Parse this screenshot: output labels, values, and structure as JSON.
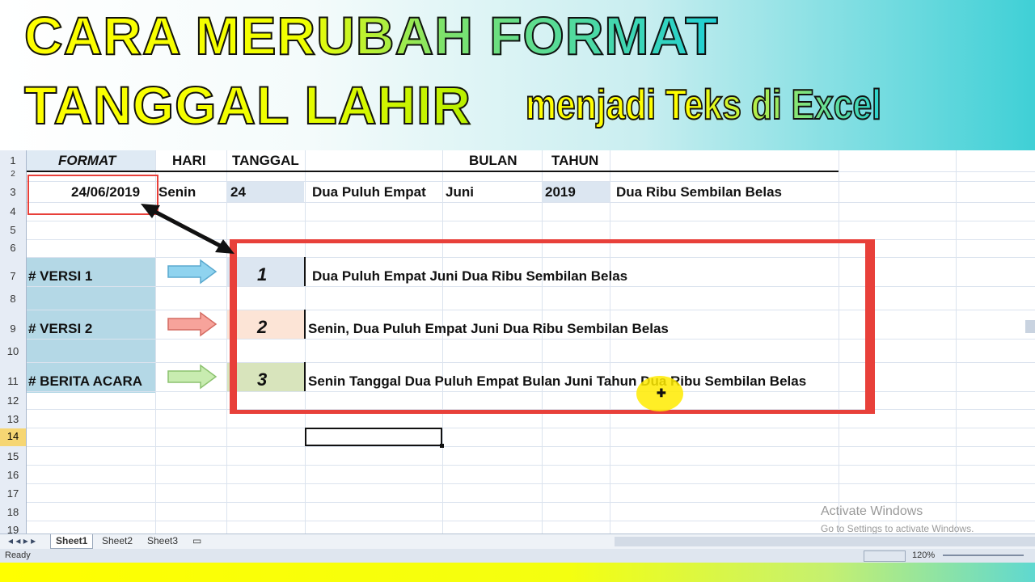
{
  "title": {
    "line1": "CARA MERUBAH FORMAT",
    "line2": "TANGGAL LAHIR",
    "line3": "menjadi Teks di Excel"
  },
  "headers": {
    "format": "FORMAT",
    "hari": "HARI",
    "tanggal": "TANGGAL",
    "bulan": "BULAN",
    "tahun": "TAHUN"
  },
  "row3": {
    "date": "24/06/2019",
    "day": "Senin",
    "tgl": "24",
    "tgl_text": "Dua Puluh Empat",
    "bulan": "Juni",
    "tahun": "2019",
    "tahun_text": "Dua Ribu Sembilan Belas"
  },
  "rows": [
    {
      "label": "# VERSI 1",
      "num": "1",
      "text": "Dua Puluh Empat Juni  Dua Ribu Sembilan Belas",
      "arrow_color": "#8fd3ef"
    },
    {
      "label": "# VERSI 2",
      "num": "2",
      "text": "Senin,  Dua Puluh Empat Juni  Dua Ribu Sembilan Belas",
      "arrow_color": "#f7a39b"
    },
    {
      "label": "# BERITA ACARA",
      "num": "3",
      "text": "Senin Tanggal  Dua Puluh Empat Bulan Juni Tahun  Dua Ribu Sembilan Belas",
      "arrow_color": "#c8ecb0"
    }
  ],
  "row_numbers": [
    "1",
    "2",
    "3",
    "4",
    "5",
    "6",
    "7",
    "8",
    "9",
    "10",
    "11",
    "12",
    "13",
    "14",
    "15",
    "16",
    "17",
    "18",
    "19"
  ],
  "sheet_tabs": [
    "Sheet1",
    "Sheet2",
    "Sheet3"
  ],
  "status": {
    "ready": "Ready",
    "zoom": "120%"
  },
  "watermark": {
    "line1": "Activate Windows",
    "line2": "Go to Settings to activate Windows."
  },
  "colors": {
    "accent_red": "#e8403a",
    "label_blue": "#b4d8e6",
    "num_blue": "#dce6f1",
    "num_peach": "#fce4d6",
    "num_green": "#d8e4bc"
  }
}
